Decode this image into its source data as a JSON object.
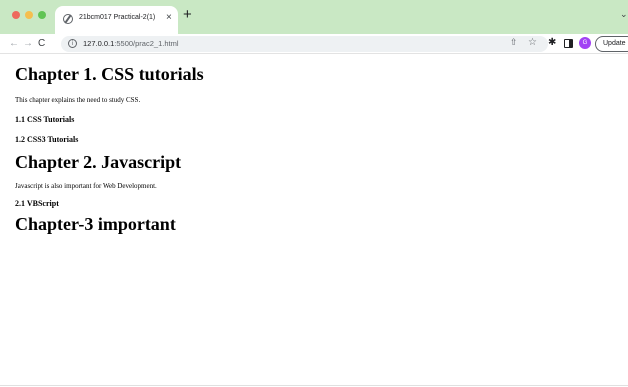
{
  "browser": {
    "tab": {
      "title": "21bcm017 Practical-2(1)",
      "close_glyph": "×"
    },
    "new_tab_glyph": "+",
    "tab_dropdown_glyph": "⌄",
    "nav": {
      "back_glyph": "←",
      "forward_glyph": "→",
      "reload_glyph": "C"
    },
    "url": {
      "host": "127.0.0.1",
      "path": ":5500/prac2_1.html"
    },
    "icons": {
      "info": "ⓘ",
      "share": "⇧",
      "star": "☆",
      "extensions": "✱"
    },
    "profile_initial": "G",
    "update_label": "Update"
  },
  "page": {
    "chapter1": {
      "heading": "Chapter 1. CSS tutorials",
      "text": "This chapter explains the need to study CSS.",
      "sub1": "1.1 CSS Tutorials",
      "sub2": "1.2 CSS3 Tutorials"
    },
    "chapter2": {
      "heading": "Chapter 2. Javascript",
      "text": "Javascript is also important for Web Development.",
      "sub1": "2.1 VBScript"
    },
    "chapter3": {
      "heading": "Chapter-3 important"
    }
  },
  "colors": {
    "tab_strip": "#c9e8c4",
    "omnibox": "#eef1f3",
    "avatar": "#a142f4",
    "traffic_red": "#ed6a5e",
    "traffic_yellow": "#f5bf4f",
    "traffic_green": "#61c454"
  }
}
